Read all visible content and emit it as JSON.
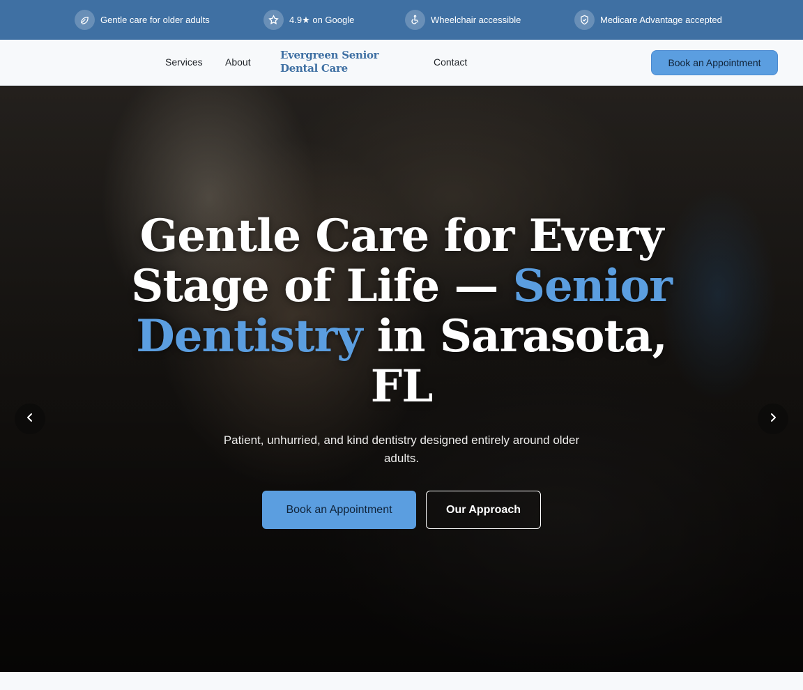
{
  "topbar": {
    "items": [
      {
        "label": "Gentle care for older adults",
        "icon": "leaf-icon"
      },
      {
        "label": "4.9★ on Google",
        "icon": "star-icon"
      },
      {
        "label": "Wheelchair accessible",
        "icon": "wheelchair-icon"
      },
      {
        "label": "Medicare Advantage accepted",
        "icon": "shield-check-icon"
      }
    ],
    "background": "#3f70a3"
  },
  "nav": {
    "links": [
      "Services",
      "About",
      "Contact"
    ],
    "brand": "Evergreen Senior Dental Care",
    "cta_label": "Book an Appointment"
  },
  "hero": {
    "title_part1": "Gentle Care for Every Stage of Life — ",
    "title_accent": "Senior Dentistry",
    "title_part2": " in Sarasota, FL",
    "subtitle": "Patient, unhurried, and kind dentistry designed entirely around older adults.",
    "primary_button": "Book an Appointment",
    "secondary_button": "Our Approach",
    "prev_icon": "chevron-left-icon",
    "next_icon": "chevron-right-icon"
  },
  "colors": {
    "accent": "#5b9ee0",
    "brand": "#3f70a3"
  }
}
